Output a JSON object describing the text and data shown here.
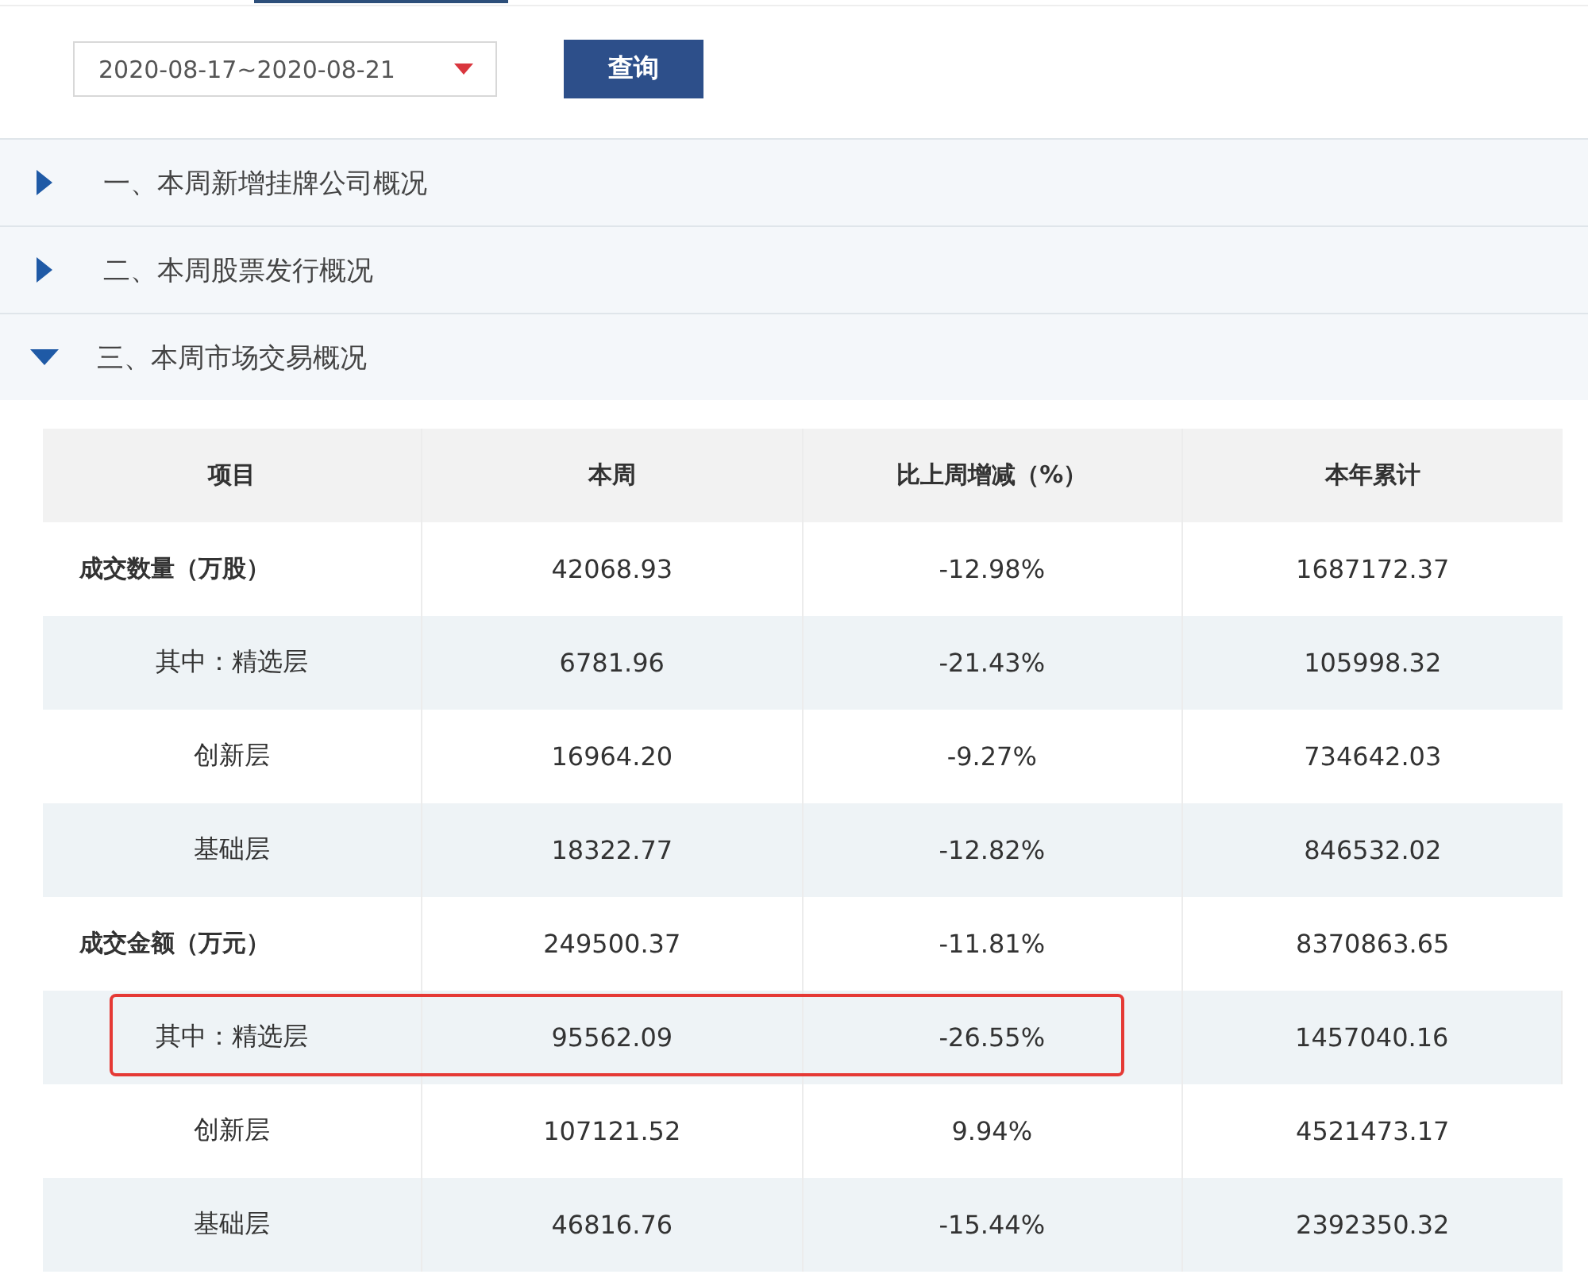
{
  "date_range": {
    "value": "2020-08-17~2020-08-21"
  },
  "query_button": "查询",
  "sections": [
    {
      "title": "一、本周新增挂牌公司概况",
      "expanded": false
    },
    {
      "title": "二、本周股票发行概况",
      "expanded": false
    },
    {
      "title": "三、本周市场交易概况",
      "expanded": true
    }
  ],
  "table": {
    "columns": [
      "项目",
      "本周",
      "比上周增减（%）",
      "本年累计"
    ],
    "rows": [
      {
        "kind": "total",
        "cells": [
          "成交数量（万股）",
          "42068.93",
          "-12.98%",
          "1687172.37"
        ],
        "highlighted": false
      },
      {
        "kind": "sub",
        "cells": [
          "其中：精选层",
          "6781.96",
          "-21.43%",
          "105998.32"
        ],
        "highlighted": false
      },
      {
        "kind": "sub",
        "cells": [
          "创新层",
          "16964.20",
          "-9.27%",
          "734642.03"
        ],
        "highlighted": false
      },
      {
        "kind": "sub",
        "cells": [
          "基础层",
          "18322.77",
          "-12.82%",
          "846532.02"
        ],
        "highlighted": false
      },
      {
        "kind": "total",
        "cells": [
          "成交金额（万元）",
          "249500.37",
          "-11.81%",
          "8370863.65"
        ],
        "highlighted": false
      },
      {
        "kind": "sub",
        "cells": [
          "其中：精选层",
          "95562.09",
          "-26.55%",
          "1457040.16"
        ],
        "highlighted": true
      },
      {
        "kind": "sub",
        "cells": [
          "创新层",
          "107121.52",
          "9.94%",
          "4521473.17"
        ],
        "highlighted": false
      },
      {
        "kind": "sub",
        "cells": [
          "基础层",
          "46816.76",
          "-15.44%",
          "2392350.32"
        ],
        "highlighted": false
      }
    ]
  }
}
